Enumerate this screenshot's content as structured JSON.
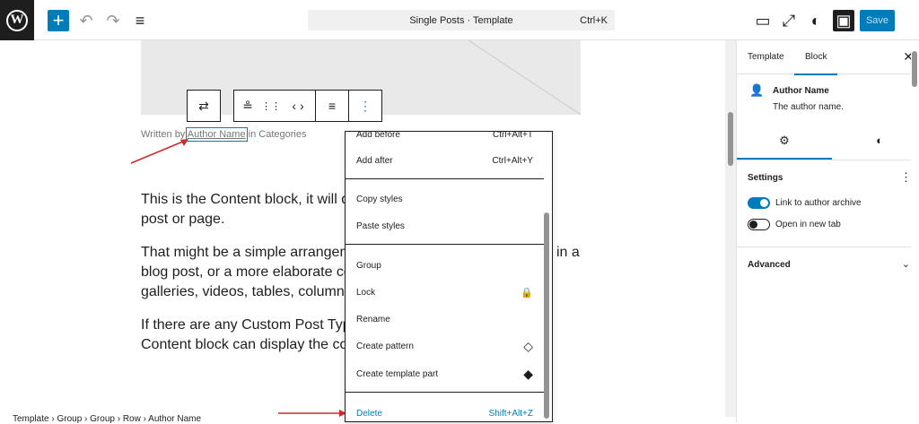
{
  "topbar": {
    "logo_letter": "W",
    "add_icon": "+",
    "undo_icon": "↶",
    "redo_icon": "↷",
    "listview_icon": "≡",
    "command": {
      "title": "Single Posts · Template",
      "shortcut": "Ctrl+K"
    },
    "preview_icon": "▭",
    "external_icon": "⤢",
    "styles_icon": "◐",
    "settings_icon": "▣",
    "save_label": "Save"
  },
  "canvas": {
    "toolbar": {
      "transform_icon": "⇄",
      "author_icon": "≗",
      "drag_icon": "⋮⋮",
      "move_icon": "‹ ›",
      "align_icon": "≡",
      "options_icon": "⋮"
    },
    "written_by": {
      "prefix": "Written by ",
      "author": "Author Name",
      "suffix": " in Categories"
    },
    "paragraphs": [
      "This is the Content block, it will d",
      "post or page.",
      "That might be a simple arrangem",
      "in a",
      "blog post, or a more elaborate co",
      "galleries, videos, tables, column",
      "If there are any Custom Post Typ",
      "Content block can display the co"
    ]
  },
  "context_menu": {
    "items": [
      {
        "label": "Add before",
        "shortcut": "Ctrl+Alt+T"
      },
      {
        "label": "Add after",
        "shortcut": "Ctrl+Alt+Y"
      },
      {
        "label": "Copy styles",
        "shortcut": ""
      },
      {
        "label": "Paste styles",
        "shortcut": ""
      },
      {
        "label": "Group",
        "shortcut": ""
      },
      {
        "label": "Lock",
        "shortcut": ""
      },
      {
        "label": "Rename",
        "shortcut": ""
      },
      {
        "label": "Create pattern",
        "shortcut": ""
      },
      {
        "label": "Create template part",
        "shortcut": ""
      },
      {
        "label": "Delete",
        "shortcut": "Shift+Alt+Z"
      }
    ],
    "lock_icon": "🔒",
    "pattern_icon": "◇",
    "template_part_icon": "◆"
  },
  "breadcrumb": "Template  ›  Group  ›  Group  ›  Row  ›  Author Name",
  "sidebar": {
    "tabs": [
      "Template",
      "Block"
    ],
    "active_tab": "Block",
    "close_icon": "✕",
    "block": {
      "icon": "👤",
      "name": "Author Name",
      "description": "The author name."
    },
    "sub_tabs": {
      "settings_icon": "⚙",
      "styles_icon": "◐"
    },
    "settings": {
      "title": "Settings",
      "more_icon": "⋮",
      "toggles": [
        {
          "label": "Link to author archive",
          "on": true
        },
        {
          "label": "Open in new tab",
          "on": false
        }
      ]
    },
    "advanced": {
      "title": "Advanced",
      "chevron": "⌄"
    }
  },
  "colors": {
    "accent": "#007cba",
    "dark": "#1e1e1e",
    "arrow": "#cc2b2b"
  }
}
